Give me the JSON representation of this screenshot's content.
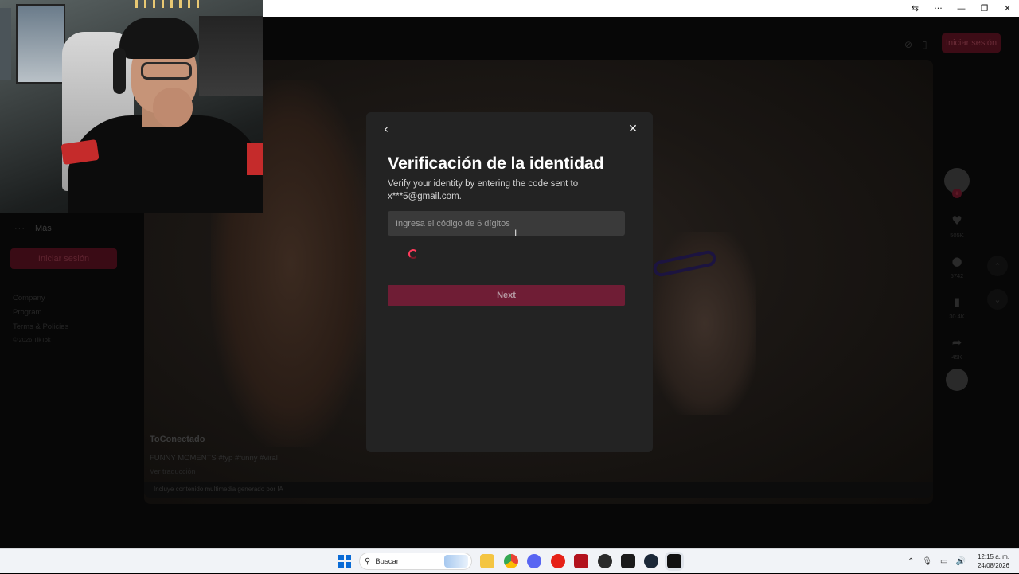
{
  "window": {
    "translate_icon": "translate-icon",
    "more_icon": "more-icon",
    "minimize_icon": "minimize-icon",
    "restore_icon": "restore-icon",
    "close_icon": "close-icon"
  },
  "header": {
    "login_label": "Iniciar sesión"
  },
  "sidebar": {
    "more_label": "Más",
    "login_label": "Iniciar sesión",
    "links": [
      "Company",
      "Program",
      "Terms & Policies"
    ],
    "copyright": "© 2026 TikTok"
  },
  "video": {
    "author": "ToConectado",
    "caption": "FUNNY MOMENTS #fyp #funny #viral",
    "translate": "Ver traducción",
    "ai_notice": "Incluye contenido multimedia generado por IA",
    "likes": "505K",
    "comments": "5742",
    "saves": "30.4K",
    "shares": "45K"
  },
  "modal": {
    "title": "Verificación de la identidad",
    "subtitle": "Verify your identity by entering the code sent to x***5@gmail.com.",
    "code_placeholder": "Ingresa el código de 6 dígitos",
    "code_value": "",
    "next_label": "Next",
    "accent": "#fe2c55"
  },
  "taskbar": {
    "search_label": "Buscar",
    "time": "12:15 a. m.",
    "date": "24/08/2026"
  }
}
